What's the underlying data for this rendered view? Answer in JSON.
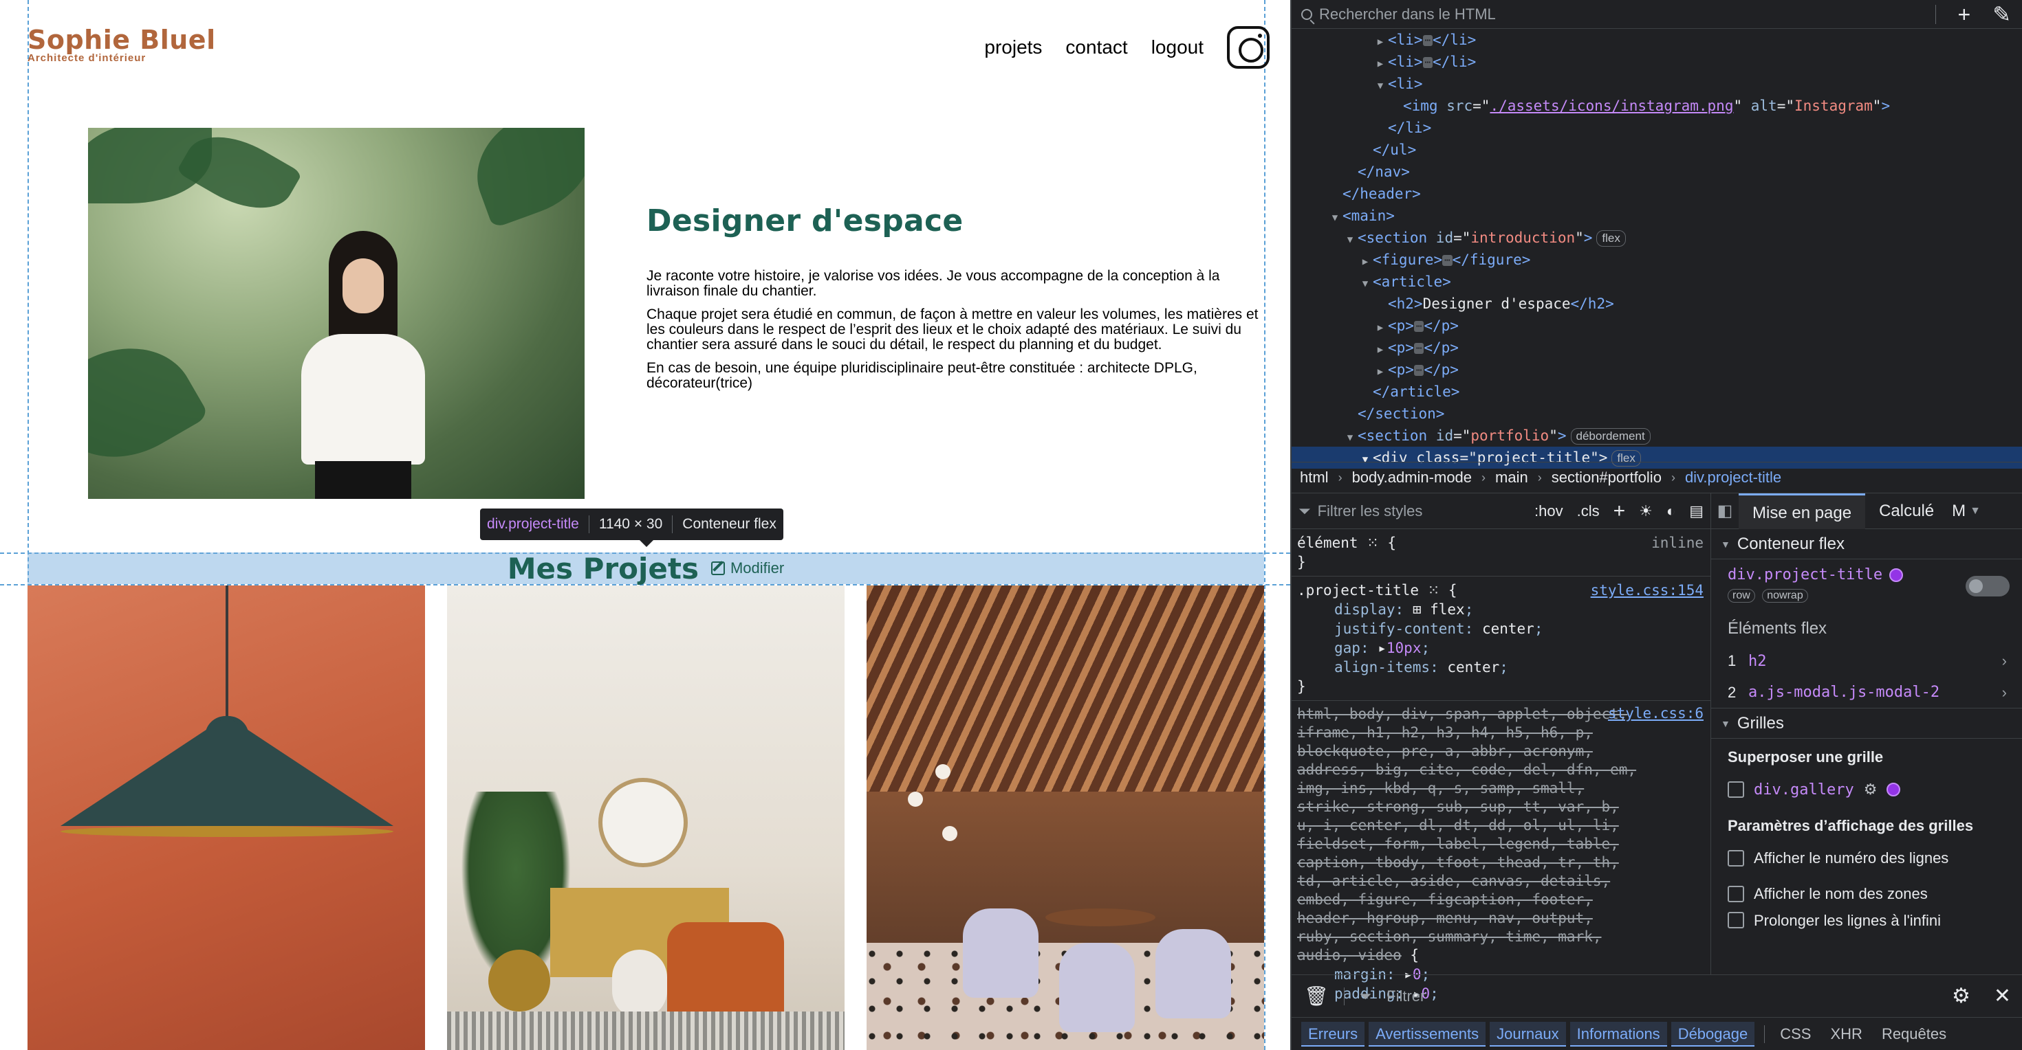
{
  "site": {
    "logo_title": "Sophie Bluel",
    "logo_subtitle": "Architecte d'intérieur",
    "nav": [
      "projets",
      "contact",
      "logout"
    ],
    "instagram_icon": "instagram-icon",
    "intro_title": "Designer d'espace",
    "intro_paragraphs": [
      "Je raconte votre histoire, je valorise vos idées. Je vous accompagne de la conception à la livraison finale du chantier.",
      "Chaque projet sera étudié en commun, de façon à mettre en valeur les volumes, les matières et les couleurs dans le respect de l’esprit des lieux et le choix adapté des matériaux. Le suivi du chantier sera assuré dans le souci du détail, le respect du planning et du budget.",
      "En cas de besoin, une équipe pluridisciplinaire peut-être constituée : architecte DPLG, décorateur(trice)"
    ],
    "portfolio_title": "Mes Projets",
    "modifier_label": "Modifier",
    "brand_color": "#B1663C",
    "title_color": "#1D6154"
  },
  "tooltip": {
    "selector": "div.project-title",
    "size": "1140 × 30",
    "kind": "Conteneur flex"
  },
  "devtools": {
    "search_placeholder": "Rechercher dans le HTML",
    "breadcrumb": [
      "html",
      "body.admin-mode",
      "main",
      "section#portfolio",
      "div.project-title"
    ],
    "tree": {
      "img_src": "./assets/icons/instagram.png",
      "img_alt": "Instagram",
      "h2_text": "Designer d'espace",
      "introduction_id": "introduction",
      "portfolio_id": "portfolio",
      "project_title_class": "project-title",
      "badge_flex": "flex",
      "badge_overflow": "débordement"
    },
    "styles": {
      "filter_placeholder": "Filtrer les styles",
      "hov": ":hov",
      "cls": ".cls",
      "element_selector": "élément",
      "inline_label": "inline",
      "rule1_selector": ".project-title",
      "rule1_source": "style.css:154",
      "rule1_props": [
        {
          "name": "display",
          "value": "flex"
        },
        {
          "name": "justify-content",
          "value": "center"
        },
        {
          "name": "gap",
          "value": "10px"
        },
        {
          "name": "align-items",
          "value": "center"
        }
      ],
      "rule2_source": "style.css:6",
      "rule2_selector_list": "html, body, div, span, applet, object, iframe, h1, h2, h3, h4, h5, h6, p, blockquote, pre, a, abbr, acronym, address, big, cite, code, del, dfn, em, img, ins, kbd, q, s, samp, small, strike, strong, sub, sup, tt, var, b, u, i, center, dl, dt, dd, ol, ul, li, fieldset, form, label, legend, table, caption, tbody, tfoot, thead, tr, th, td, article, aside, canvas, details, embed, figure, figcaption, footer, header, hgroup, menu, nav, output, ruby, section, summary, time, mark, audio, video",
      "rule2_props": [
        {
          "name": "margin",
          "value": "0"
        },
        {
          "name": "padding",
          "value": "0"
        }
      ]
    },
    "layout": {
      "tabs": [
        "Mise en page",
        "Calculé",
        "M"
      ],
      "flex_section": "Conteneur flex",
      "flex_container": "div.project-title",
      "flex_badges": [
        "row",
        "nowrap"
      ],
      "flex_items_head": "Éléments flex",
      "flex_items": [
        {
          "n": "1",
          "name": "h2"
        },
        {
          "n": "2",
          "name": "a.js-modal.js-modal-2"
        }
      ],
      "grid_section": "Grilles",
      "grid_overlay_head": "Superposer une grille",
      "grid_item": "div.gallery",
      "grid_settings_head": "Paramètres d’affichage des grilles",
      "grid_settings": [
        "Afficher le numéro des lignes",
        "Afficher le nom des zones",
        "Prolonger les lignes à l'infini"
      ]
    },
    "console": {
      "filter_placeholder": "Filtrer",
      "tabs_active": [
        "Erreurs",
        "Avertissements",
        "Journaux",
        "Informations",
        "Débogage"
      ],
      "tabs_other": [
        "CSS",
        "XHR",
        "Requêtes"
      ]
    }
  }
}
